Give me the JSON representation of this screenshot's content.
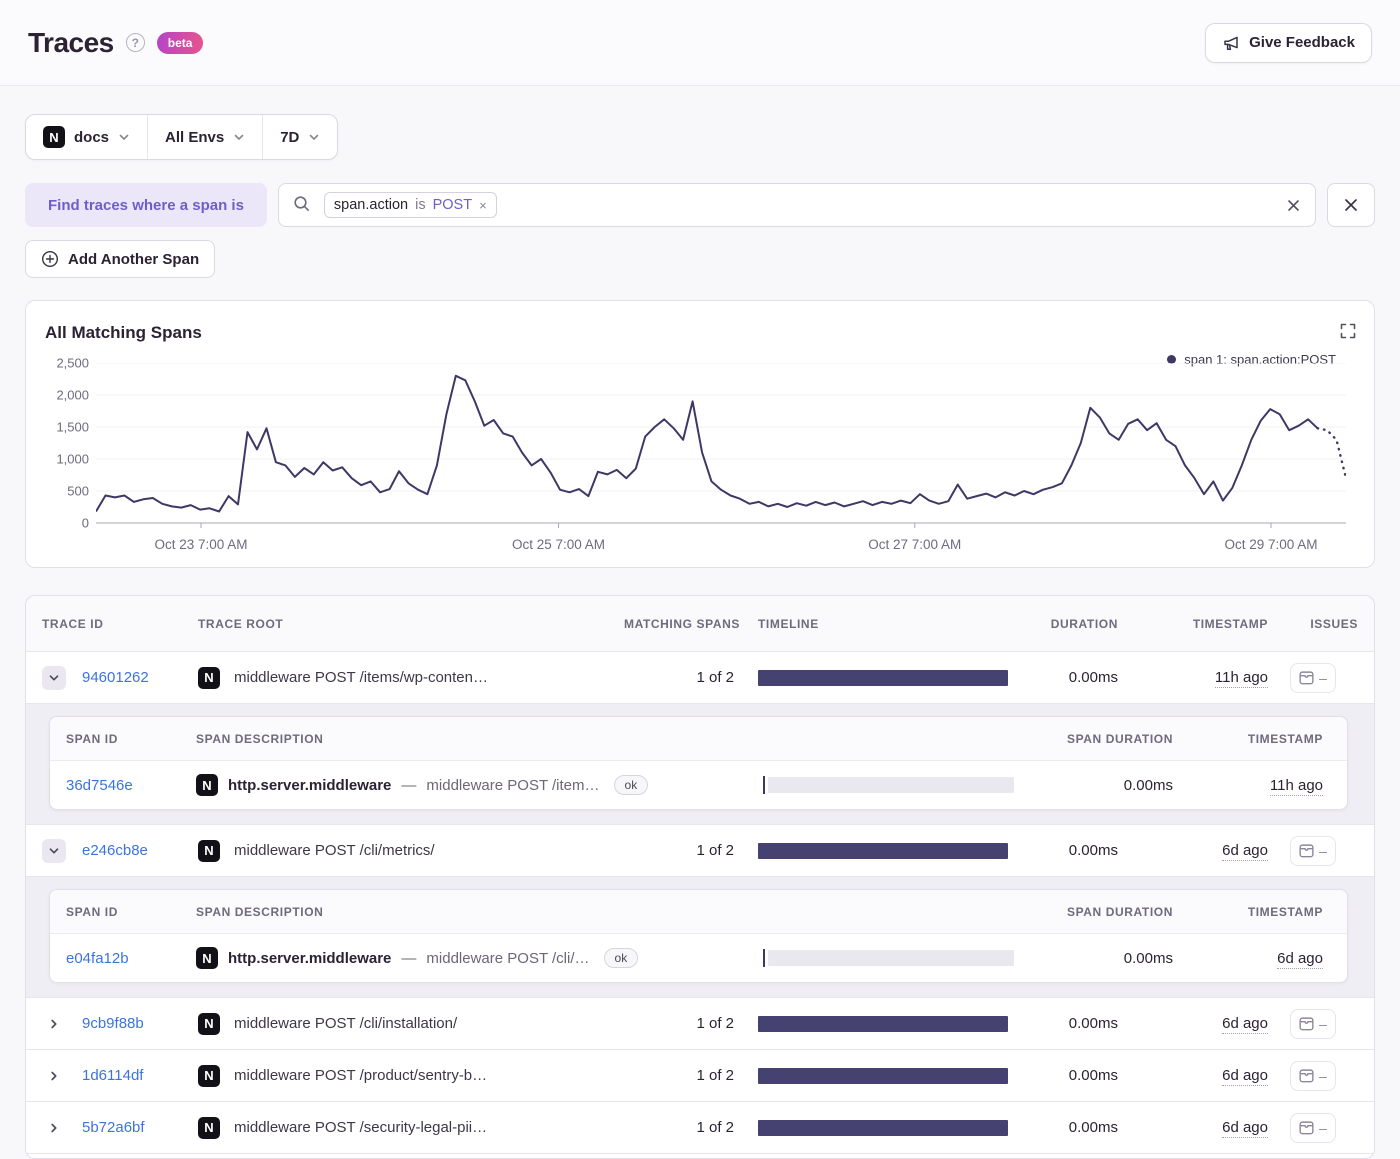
{
  "page": {
    "title": "Traces",
    "beta_label": "beta",
    "feedback_label": "Give Feedback"
  },
  "colors": {
    "accent_purple": "#6d5fc7",
    "link_blue": "#3c74db",
    "bar_navy": "#454170",
    "line_navy": "#3e3866",
    "beta_start": "#b445c8",
    "beta_end": "#e8548b"
  },
  "filters": {
    "project": "docs",
    "environment": "All Envs",
    "period": "7D"
  },
  "span_query": {
    "chip_label": "Find traces where a span is",
    "token": {
      "key": "span.action",
      "op": "is",
      "value": "POST",
      "remove": "×"
    },
    "add_label": "Add Another Span"
  },
  "chart": {
    "title": "All Matching Spans",
    "legend": "span 1: span.action:POST"
  },
  "chart_data": {
    "type": "line",
    "title": "All Matching Spans",
    "legend": [
      "span 1: span.action:POST"
    ],
    "ylim": [
      0,
      2500
    ],
    "grid": true,
    "dashed_tail_points": 4,
    "y_ticks": [
      {
        "label": "0",
        "value": 0
      },
      {
        "label": "500",
        "value": 500
      },
      {
        "label": "1,000",
        "value": 1000
      },
      {
        "label": "1,500",
        "value": 1500
      },
      {
        "label": "2,000",
        "value": 2000
      },
      {
        "label": "2,500",
        "value": 2500
      }
    ],
    "x_ticks": [
      {
        "label": "Oct 23 7:00 AM",
        "f": 0.084
      },
      {
        "label": "Oct 25 7:00 AM",
        "f": 0.37
      },
      {
        "label": "Oct 27 7:00 AM",
        "f": 0.655
      },
      {
        "label": "Oct 29 7:00 AM",
        "f": 0.94
      }
    ],
    "values": [
      180,
      430,
      400,
      430,
      330,
      370,
      390,
      300,
      260,
      240,
      280,
      210,
      230,
      180,
      420,
      290,
      1420,
      1150,
      1480,
      950,
      900,
      720,
      860,
      760,
      950,
      820,
      870,
      700,
      590,
      650,
      480,
      530,
      810,
      620,
      520,
      450,
      900,
      1700,
      2300,
      2230,
      1900,
      1520,
      1610,
      1400,
      1350,
      1100,
      900,
      1000,
      790,
      520,
      480,
      530,
      420,
      800,
      760,
      830,
      700,
      850,
      1350,
      1500,
      1620,
      1480,
      1300,
      1900,
      1100,
      650,
      520,
      430,
      380,
      300,
      330,
      260,
      300,
      250,
      310,
      270,
      330,
      280,
      320,
      260,
      300,
      340,
      280,
      330,
      300,
      350,
      310,
      450,
      350,
      300,
      340,
      600,
      380,
      420,
      460,
      400,
      480,
      430,
      500,
      450,
      520,
      560,
      620,
      900,
      1250,
      1800,
      1650,
      1400,
      1300,
      1550,
      1620,
      1450,
      1560,
      1300,
      1200,
      900,
      700,
      450,
      650,
      350,
      550,
      900,
      1300,
      1600,
      1780,
      1700,
      1450,
      1520,
      1620,
      1480,
      1450,
      1300,
      700
    ]
  },
  "table": {
    "headers": {
      "trace_id": "TRACE ID",
      "trace_root": "TRACE ROOT",
      "matching": "MATCHING SPANS",
      "timeline": "TIMELINE",
      "duration": "DURATION",
      "timestamp": "TIMESTAMP",
      "issues": "ISSUES"
    },
    "span_headers": {
      "h_span_id": "SPAN ID",
      "h_desc": "SPAN DESCRIPTION",
      "h_dur": "SPAN DURATION",
      "h_ts": "TIMESTAMP"
    },
    "separator": "—",
    "issues_empty": "–",
    "rows": [
      {
        "expanded": true,
        "trace_id": "94601262",
        "root": "middleware POST /items/wp-conten…",
        "matching": "1 of 2",
        "duration": "0.00ms",
        "timestamp": "11h ago",
        "spans": [
          {
            "span_id": "36d7546e",
            "op": "http.server.middleware",
            "desc": "middleware POST /item…",
            "status": "ok",
            "duration": "0.00ms",
            "timestamp": "11h ago"
          }
        ]
      },
      {
        "expanded": true,
        "trace_id": "e246cb8e",
        "root": "middleware POST /cli/metrics/",
        "matching": "1 of 2",
        "duration": "0.00ms",
        "timestamp": "6d ago",
        "spans": [
          {
            "span_id": "e04fa12b",
            "op": "http.server.middleware",
            "desc": "middleware POST /cli/…",
            "status": "ok",
            "duration": "0.00ms",
            "timestamp": "6d ago"
          }
        ]
      },
      {
        "expanded": false,
        "trace_id": "9cb9f88b",
        "root": "middleware POST /cli/installation/",
        "matching": "1 of 2",
        "duration": "0.00ms",
        "timestamp": "6d ago",
        "spans": []
      },
      {
        "expanded": false,
        "trace_id": "1d6114df",
        "root": "middleware POST /product/sentry-b…",
        "matching": "1 of 2",
        "duration": "0.00ms",
        "timestamp": "6d ago",
        "spans": []
      },
      {
        "expanded": false,
        "trace_id": "5b72a6bf",
        "root": "middleware POST /security-legal-pii…",
        "matching": "1 of 2",
        "duration": "0.00ms",
        "timestamp": "6d ago",
        "spans": []
      }
    ]
  }
}
